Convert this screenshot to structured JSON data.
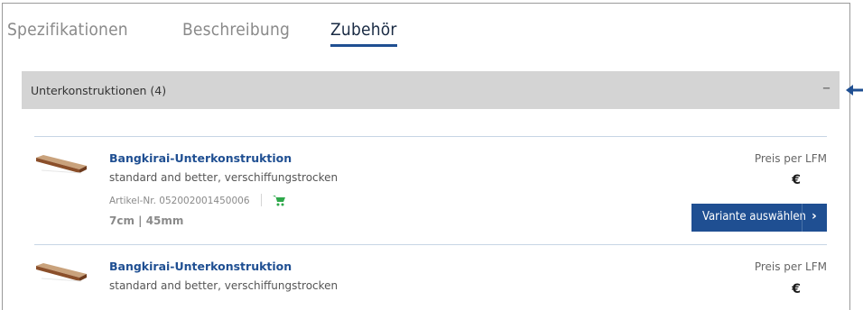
{
  "tabs": [
    {
      "label": "Spezifikationen",
      "active": false
    },
    {
      "label": "Beschreibung",
      "active": false
    },
    {
      "label": "Zubehör",
      "active": true
    }
  ],
  "accordion": {
    "title": "Unterkonstruktionen (4)",
    "toggle": "–"
  },
  "products": [
    {
      "title": "Bangkirai-Unterkonstruktion",
      "description": "standard and better, verschiffungstrocken",
      "article": "Artikel-Nr. 052002001450006",
      "dimensions": "7cm | 45mm",
      "price_label": "Preis per LFM",
      "price": "€",
      "button_label": "Variante auswählen",
      "button_icon": "›"
    },
    {
      "title": "Bangkirai-Unterkonstruktion",
      "description": "standard and better, verschiffungstrocken",
      "price_label": "Preis per LFM",
      "price": "€"
    }
  ],
  "colors": {
    "accent": "#1f4f92",
    "cart": "#2ea84a",
    "accordion_bg": "#d4d4d4"
  }
}
